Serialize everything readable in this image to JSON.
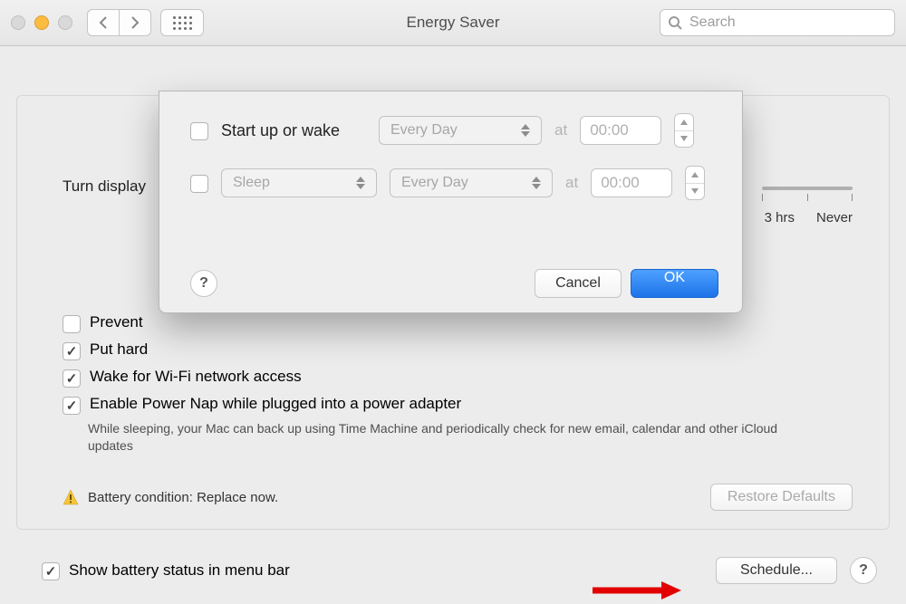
{
  "window": {
    "title": "Energy Saver"
  },
  "toolbar": {
    "search_placeholder": "Search"
  },
  "panel": {
    "turn_display_label": "Turn display",
    "slider": {
      "t1": "3 hrs",
      "t2": "Never"
    },
    "checks": {
      "prevent": "Prevent",
      "put_hard": "Put hard",
      "wake_wifi": "Wake for Wi-Fi network access",
      "power_nap": "Enable Power Nap while plugged into a power adapter",
      "power_nap_desc": "While sleeping, your Mac can back up using Time Machine and periodically check for new email, calendar and other iCloud updates"
    },
    "battery_status": "Battery condition: Replace now.",
    "restore_defaults": "Restore Defaults"
  },
  "footer": {
    "show_battery": "Show battery status in menu bar",
    "schedule_btn": "Schedule..."
  },
  "sheet": {
    "start_label": "Start up or wake",
    "every_day": "Every Day",
    "sleep": "Sleep",
    "at": "at",
    "time": "00:00",
    "help": "?",
    "cancel": "Cancel",
    "ok": "OK"
  }
}
